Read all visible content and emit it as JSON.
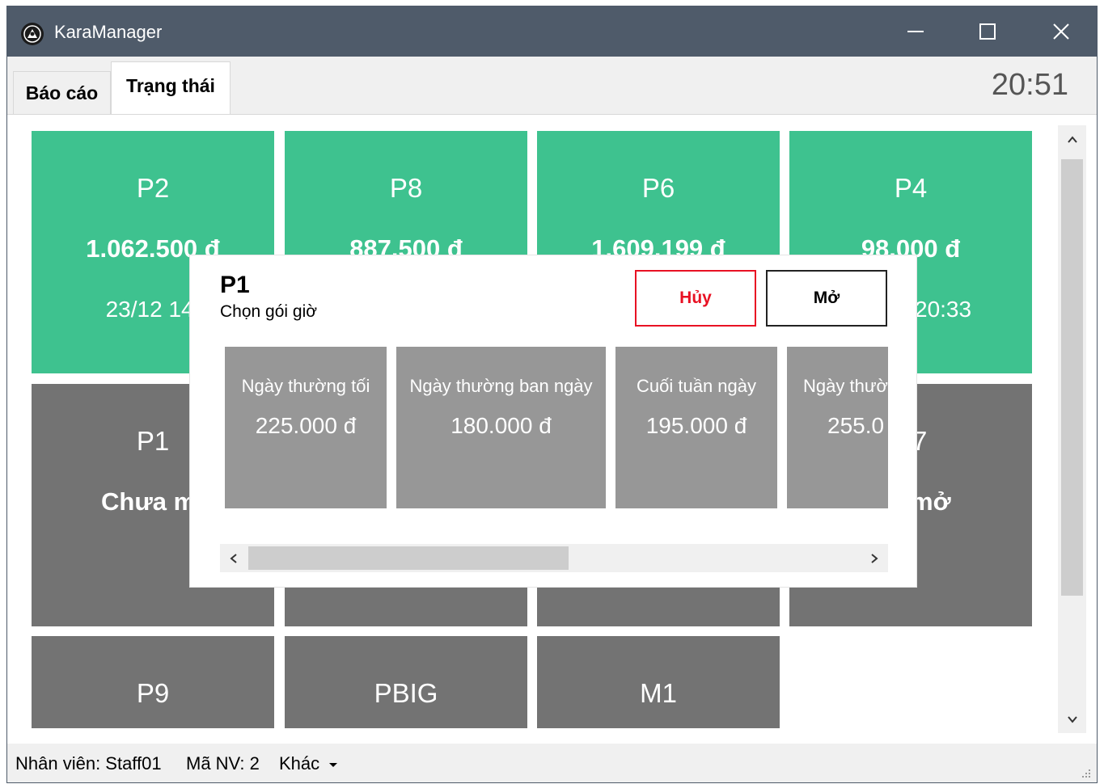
{
  "window": {
    "title": "KaraManager",
    "app_icon": "microphone-disc-icon",
    "controls": [
      "minimize-icon",
      "maximize-icon",
      "close-icon"
    ]
  },
  "tabs": [
    {
      "label": "Báo cáo",
      "selected": false
    },
    {
      "label": "Trạng thái",
      "selected": true
    }
  ],
  "clock": "20:51",
  "colors": {
    "room_active": "#3ec28f",
    "room_idle": "#737373",
    "package_tile": "#979797",
    "cancel": "#e81123",
    "titlebar": "#4f5b6a"
  },
  "rooms": [
    {
      "name": "P2",
      "total": "1.062.500 đ",
      "time": "23/12 14:",
      "state": "active"
    },
    {
      "name": "P8",
      "total": "887.500 đ",
      "state": "active"
    },
    {
      "name": "P6",
      "total": "1.609.199 đ",
      "state": "active"
    },
    {
      "name": "P4",
      "total": "98.000 đ",
      "time": "20:33",
      "state": "active"
    },
    {
      "name": "P1",
      "status": "Chưa m",
      "state": "idle"
    },
    {
      "name": "",
      "state": "idle"
    },
    {
      "name": "",
      "state": "idle"
    },
    {
      "name": "7",
      "status": " mở",
      "state": "idle"
    },
    {
      "name": "P9",
      "state": "idle"
    },
    {
      "name": "PBIG",
      "state": "idle"
    },
    {
      "name": "M1",
      "state": "idle"
    }
  ],
  "dialog": {
    "title": "P1",
    "subtitle": "Chọn gói giờ",
    "cancel_label": "Hủy",
    "open_label": "Mở",
    "packages": [
      {
        "name": "Ngày thường tối",
        "price": "225.000 đ"
      },
      {
        "name": "Ngày thường ban ngày",
        "price": "180.000 đ"
      },
      {
        "name": "Cuối tuần ngày",
        "price": "195.000 đ"
      },
      {
        "name": "Ngày thườ",
        "price": "255.0"
      }
    ]
  },
  "statusbar": {
    "staff": "Nhân viên: Staff01",
    "staff_id": "Mã NV: 2",
    "other": "Khác"
  }
}
